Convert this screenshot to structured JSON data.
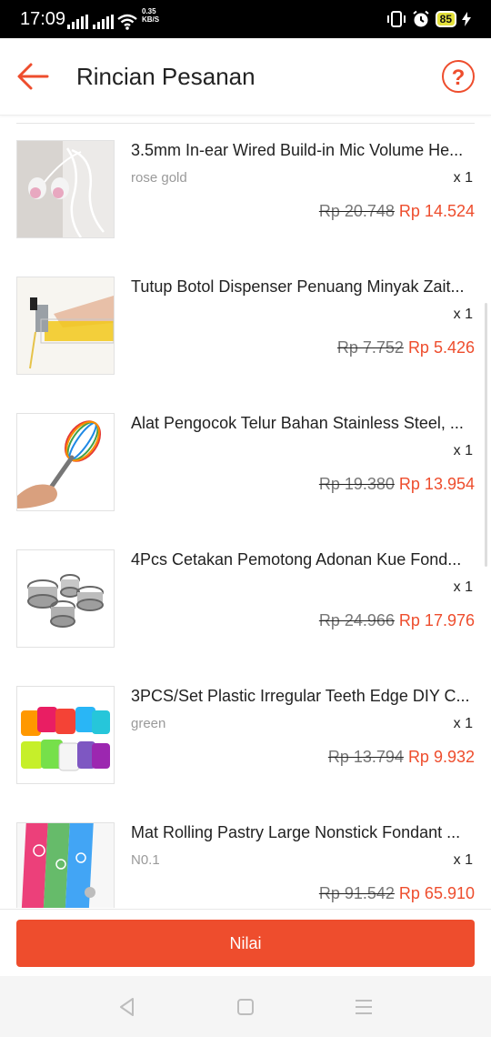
{
  "status_bar": {
    "time": "17:09",
    "net_speed_value": "0.35",
    "net_speed_unit": "KB/S",
    "battery": "85"
  },
  "header": {
    "title": "Rincian Pesanan",
    "help_label": "?"
  },
  "items": [
    {
      "name": "3.5mm In-ear Wired Build-in Mic Volume He...",
      "variant": "rose gold",
      "qty": "x 1",
      "old_price": "Rp 20.748",
      "new_price": "Rp 14.524",
      "image": "earphones"
    },
    {
      "name": "Tutup Botol Dispenser Penuang Minyak Zait...",
      "variant": "",
      "qty": "x 1",
      "old_price": "Rp 7.752",
      "new_price": "Rp 5.426",
      "image": "oil-pourer"
    },
    {
      "name": "Alat Pengocok Telur Bahan Stainless Steel, ...",
      "variant": "",
      "qty": "x 1",
      "old_price": "Rp 19.380",
      "new_price": "Rp 13.954",
      "image": "egg-whisk"
    },
    {
      "name": "4Pcs Cetakan Pemotong Adonan Kue Fond...",
      "variant": "",
      "qty": "x 1",
      "old_price": "Rp 24.966",
      "new_price": "Rp 17.976",
      "image": "cookie-cutters"
    },
    {
      "name": "3PCS/Set Plastic Irregular Teeth Edge DIY C...",
      "variant": "green",
      "qty": "x 1",
      "old_price": "Rp 13.794",
      "new_price": "Rp 9.932",
      "image": "plastic-scrapers"
    },
    {
      "name": "Mat Rolling Pastry Large Nonstick Fondant ...",
      "variant": "N0.1",
      "qty": "x 1",
      "old_price": "Rp 91.542",
      "new_price": "Rp 65.910",
      "image": "pastry-mats"
    }
  ],
  "footer": {
    "rate_button": "Nilai"
  },
  "colors": {
    "accent": "#ee4d2d",
    "status_bar": "#000000"
  }
}
